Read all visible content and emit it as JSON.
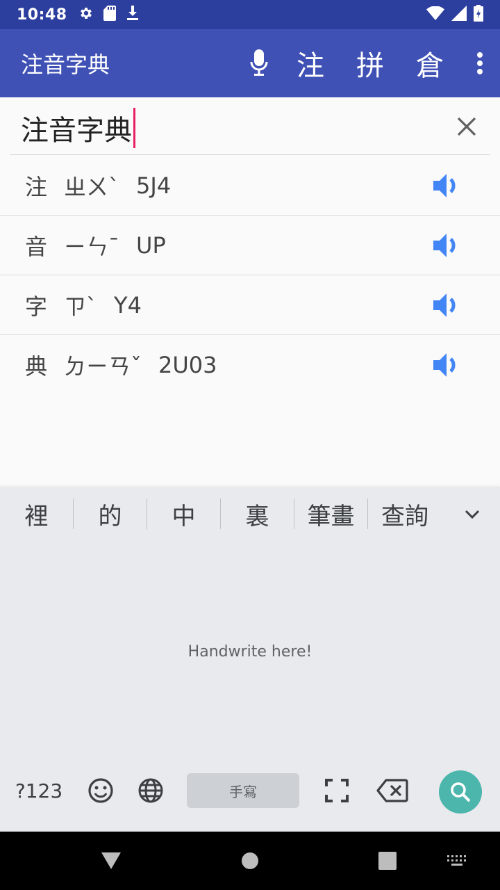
{
  "status_bar": {
    "time": "10:48",
    "left_icons": [
      "settings-icon",
      "sd-card-icon",
      "download-icon"
    ],
    "right_icons": [
      "wifi-icon",
      "signal-icon",
      "battery-icon"
    ]
  },
  "app_bar": {
    "title": "注音字典",
    "mic_icon": "microphone-icon",
    "modes": [
      {
        "label": "注"
      },
      {
        "label": "拼"
      },
      {
        "label": "倉"
      }
    ],
    "more_icon": "more-vert-icon",
    "colors": {
      "primary": "#3f51b5",
      "primary_dark": "#2c3e9e"
    }
  },
  "search": {
    "value": "注音字典",
    "clear_icon": "close-icon",
    "cursor_color": "#e91e63"
  },
  "results": [
    {
      "char": "注",
      "zhuyin": "ㄓㄨˋ",
      "code": "5J4"
    },
    {
      "char": "音",
      "zhuyin": "ㄧㄣˉ",
      "code": "UP"
    },
    {
      "char": "字",
      "zhuyin": "ㄗˋ",
      "code": "Y4"
    },
    {
      "char": "典",
      "zhuyin": "ㄉㄧㄢˇ",
      "code": "2U03"
    }
  ],
  "speaker_color": "#4285f4",
  "keyboard": {
    "suggestions": [
      "裡",
      "的",
      "中",
      "裏",
      "筆畫",
      "查詢"
    ],
    "handwrite_hint": "Handwrite here!",
    "symbols_label": "?123",
    "space_label": "手寫",
    "search_color": "#4db6ac"
  }
}
